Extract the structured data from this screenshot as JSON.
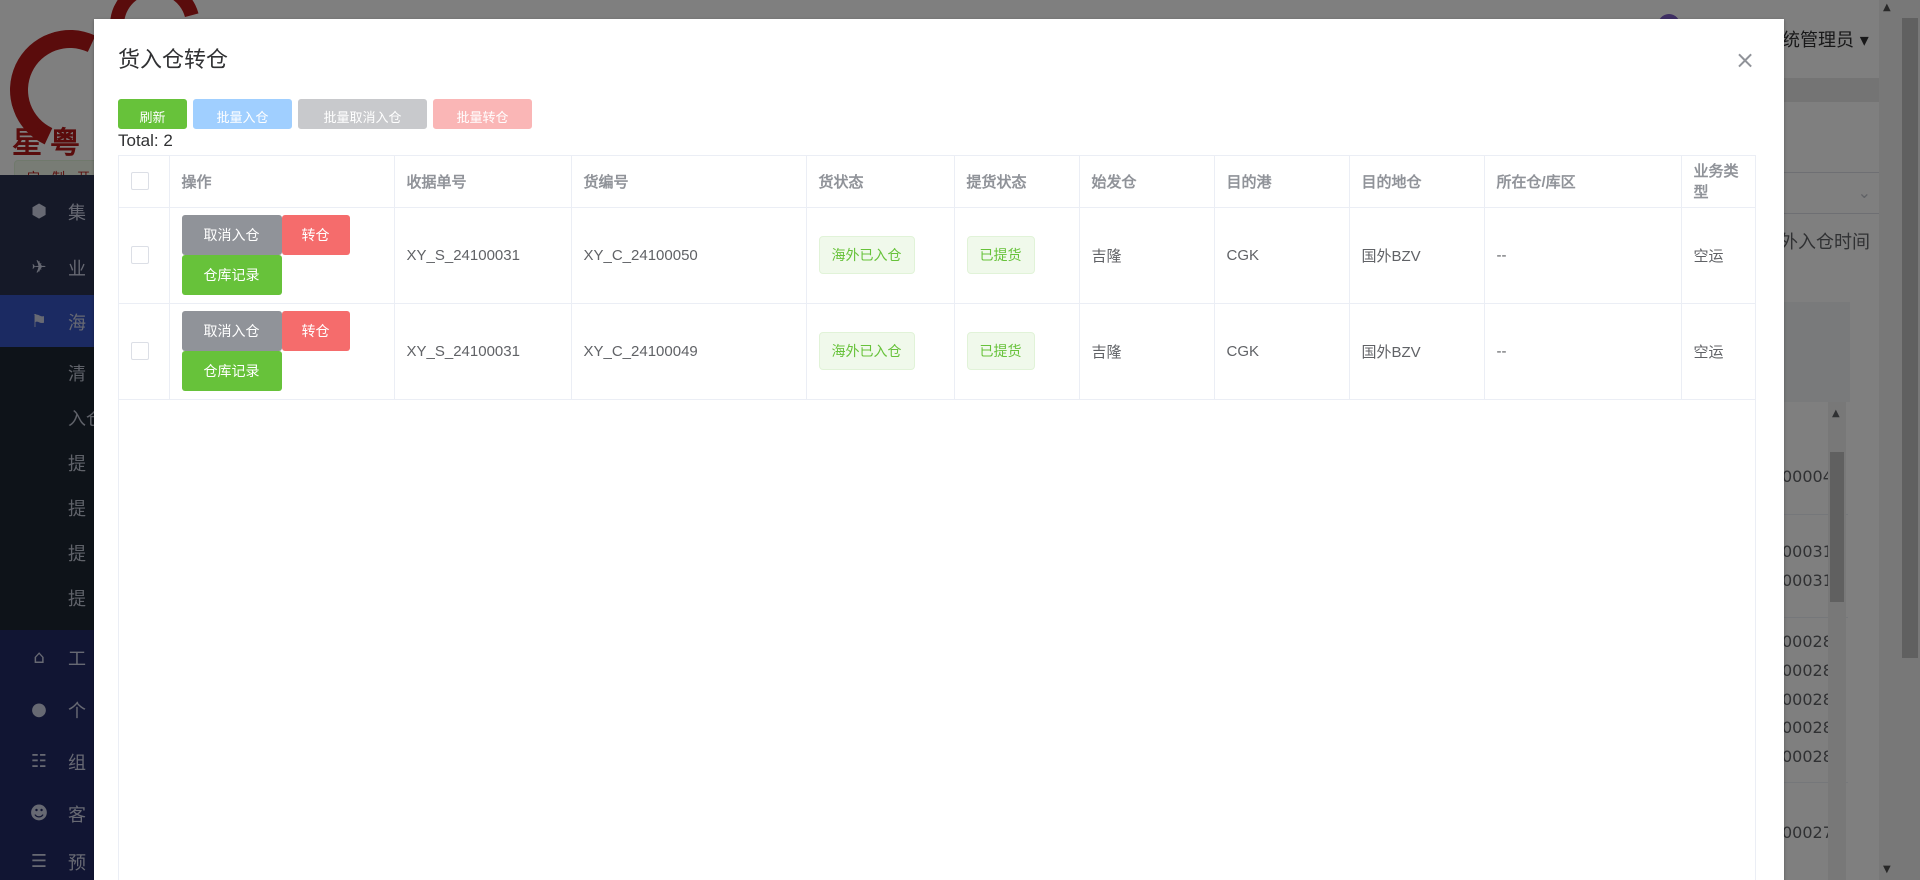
{
  "background": {
    "brand": "星粤",
    "tagline": "定制开",
    "user": "统管理员",
    "user_arrow": "▾",
    "sidebar_items": [
      {
        "label": "集",
        "icon": "cube-icon"
      },
      {
        "label": "业",
        "icon": "plane-icon"
      },
      {
        "label": "海",
        "icon": "flag-icon"
      }
    ],
    "sidebar_subitems": [
      "清",
      "入仓",
      "提",
      "提",
      "提",
      "提"
    ],
    "sidebar_lower": [
      {
        "label": "工",
        "icon": "home-icon"
      },
      {
        "label": "个",
        "icon": "user-icon"
      },
      {
        "label": "组",
        "icon": "group-icon"
      },
      {
        "label": "客",
        "icon": "users-icon"
      },
      {
        "label": "预",
        "icon": "list-icon"
      }
    ],
    "column_title": "外入仓时间",
    "rows": [
      "00004",
      "00031",
      "00031",
      "00028",
      "00028",
      "00028",
      "00028",
      "00028",
      "00027"
    ]
  },
  "dialog": {
    "title": "货入仓转仓",
    "close": "×",
    "toolbar": {
      "refresh": "刷新",
      "batch_in": "批量入仓",
      "batch_cancel": "批量取消入仓",
      "batch_transfer": "批量转仓"
    },
    "total": "Total: 2",
    "columns": [
      "操作",
      "收据单号",
      "货编号",
      "货状态",
      "提货状态",
      "始发仓",
      "目的港",
      "目的地仓",
      "所在仓/库区",
      "业务类型"
    ],
    "row_actions": {
      "cancel": "取消入仓",
      "transfer": "转仓",
      "record": "仓库记录"
    },
    "rows": [
      {
        "receipt": "XY_S_24100031",
        "cargo": "XY_C_24100050",
        "status": "海外已入仓",
        "pickup": "已提货",
        "origin": "吉隆",
        "port": "CGK",
        "dest": "国外BZV",
        "location": "--",
        "biz": "空运"
      },
      {
        "receipt": "XY_S_24100031",
        "cargo": "XY_C_24100049",
        "status": "海外已入仓",
        "pickup": "已提货",
        "origin": "吉隆",
        "port": "CGK",
        "dest": "国外BZV",
        "location": "--",
        "biz": "空运"
      }
    ]
  }
}
